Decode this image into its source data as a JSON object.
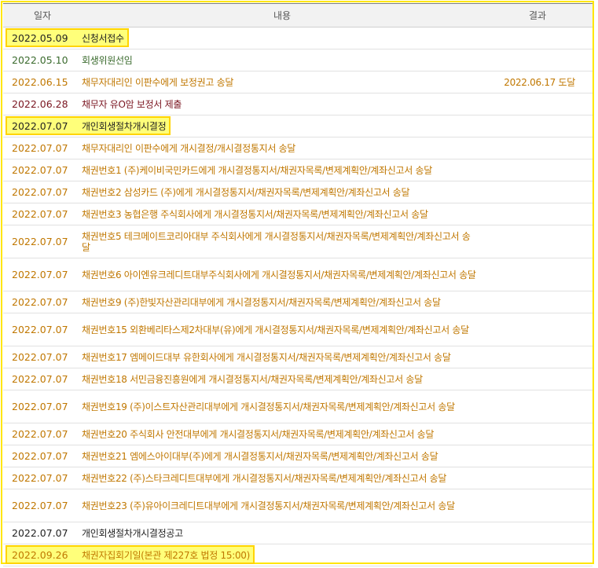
{
  "headers": {
    "date": "일자",
    "content": "내용",
    "result": "결과"
  },
  "rows": [
    {
      "date": "2022.05.09",
      "content": "신청서접수",
      "result": "",
      "color": "black",
      "hl": true,
      "h": 28
    },
    {
      "date": "2022.05.10",
      "content": "회생위원선임",
      "result": "",
      "color": "green",
      "hl": false,
      "h": 28
    },
    {
      "date": "2022.06.15",
      "content": "채무자대리인 이판수에게 보정권고 송달",
      "result": "2022.06.17 도달",
      "color": "orange",
      "hl": false,
      "h": 28
    },
    {
      "date": "2022.06.28",
      "content": "채무자 유O암 보정서 제출",
      "result": "",
      "color": "maroon",
      "hl": false,
      "h": 28
    },
    {
      "date": "2022.07.07",
      "content": "개인회생절차개시결정",
      "result": "",
      "color": "black",
      "hl": true,
      "h": 28
    },
    {
      "date": "2022.07.07",
      "content": "채무자대리인 이판수에게 개시결정/개시결정통지서 송달",
      "result": "",
      "color": "orange",
      "hl": false,
      "h": 28
    },
    {
      "date": "2022.07.07",
      "content": "채권번호1 (주)케이비국민카드에게 개시결정통지서/채권자목록/변제계획안/계좌신고서 송달",
      "result": "",
      "color": "orange",
      "hl": false,
      "h": 28
    },
    {
      "date": "2022.07.07",
      "content": "채권번호2 삼성카드 (주)에게 개시결정통지서/채권자목록/변제계획안/계좌신고서 송달",
      "result": "",
      "color": "orange",
      "hl": false,
      "h": 28
    },
    {
      "date": "2022.07.07",
      "content": "채권번호3 농협은행 주식회사에게 개시결정통지서/채권자목록/변제계획안/계좌신고서 송달",
      "result": "",
      "color": "orange",
      "hl": false,
      "h": 28
    },
    {
      "date": "2022.07.07",
      "content": "채권번호5 테크메이트코리아대부 주식회사에게 개시결정통지서/채권자목록/변제계획안/계좌신고서 송달",
      "result": "",
      "color": "orange",
      "hl": false,
      "h": 42
    },
    {
      "date": "2022.07.07",
      "content": "채권번호6 아이엔유크레디트대부주식회사에게 개시결정통지서/채권자목록/변제계획안/계좌신고서 송달",
      "result": "",
      "color": "orange",
      "hl": false,
      "h": 42
    },
    {
      "date": "2022.07.07",
      "content": "채권번호9 (주)한빛자산관리대부에게 개시결정통지서/채권자목록/변제계획안/계좌신고서 송달",
      "result": "",
      "color": "orange",
      "hl": false,
      "h": 28
    },
    {
      "date": "2022.07.07",
      "content": "채권번호15 외환베리타스제2차대부(유)에게 개시결정통지서/채권자목록/변제계획안/계좌신고서 송달",
      "result": "",
      "color": "orange",
      "hl": false,
      "h": 42
    },
    {
      "date": "2022.07.07",
      "content": "채권번호17 엠메이드대부 유한회사에게 개시결정통지서/채권자목록/변제계획안/계좌신고서 송달",
      "result": "",
      "color": "orange",
      "hl": false,
      "h": 28
    },
    {
      "date": "2022.07.07",
      "content": "채권번호18 서민금융진흥원에게 개시결정통지서/채권자목록/변제계획안/계좌신고서 송달",
      "result": "",
      "color": "orange",
      "hl": false,
      "h": 28
    },
    {
      "date": "2022.07.07",
      "content": "채권번호19 (주)이스트자산관리대부에게 개시결정통지서/채권자목록/변제계획안/계좌신고서 송달",
      "result": "",
      "color": "orange",
      "hl": false,
      "h": 42
    },
    {
      "date": "2022.07.07",
      "content": "채권번호20 주식회사 안전대부에게 개시결정통지서/채권자목록/변제계획안/계좌신고서 송달",
      "result": "",
      "color": "orange",
      "hl": false,
      "h": 28
    },
    {
      "date": "2022.07.07",
      "content": "채권번호21 엠에스아이대부(주)에게 개시결정통지서/채권자목록/변제계획안/계좌신고서 송달",
      "result": "",
      "color": "orange",
      "hl": false,
      "h": 28
    },
    {
      "date": "2022.07.07",
      "content": "채권번호22 (주)스타크레디트대부에게 개시결정통지서/채권자목록/변제계획안/계좌신고서 송달",
      "result": "",
      "color": "orange",
      "hl": false,
      "h": 28
    },
    {
      "date": "2022.07.07",
      "content": "채권번호23 (주)유아이크레디트대부에게 개시결정통지서/채권자목록/변제계획안/계좌신고서 송달",
      "result": "",
      "color": "orange",
      "hl": false,
      "h": 42
    },
    {
      "date": "2022.07.07",
      "content": "개인회생절차개시결정공고",
      "result": "",
      "color": "black",
      "hl": false,
      "h": 28
    },
    {
      "date": "2022.09.26",
      "content": "채권자집회기일(본관 제227호 법정 15:00)",
      "result": "",
      "color": "orange",
      "hl": true,
      "h": 28
    }
  ]
}
